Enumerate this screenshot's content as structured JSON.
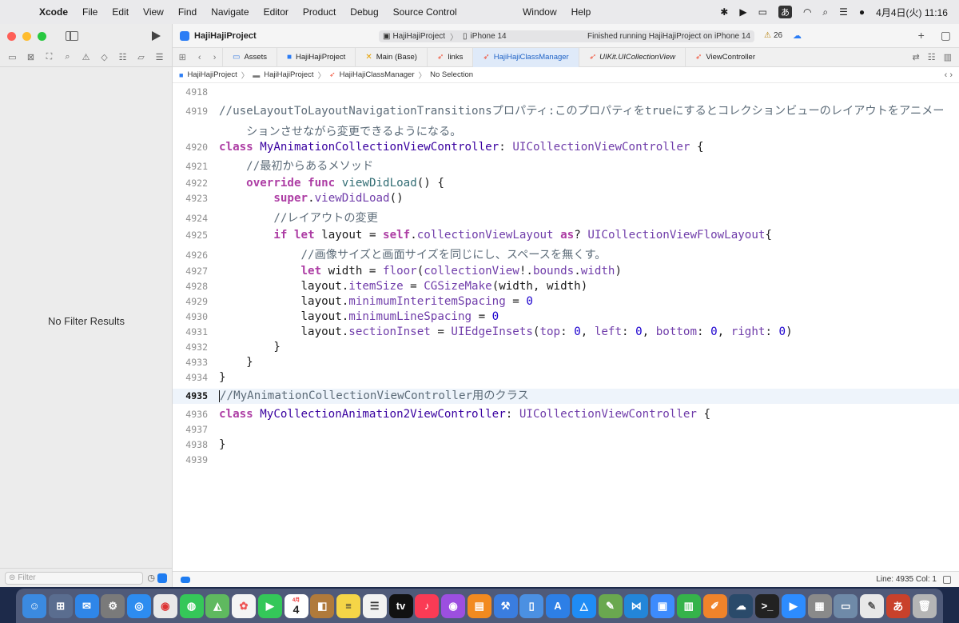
{
  "menubar": {
    "app_name": "Xcode",
    "items": [
      "File",
      "Edit",
      "View",
      "Find",
      "Navigate",
      "Editor",
      "Product",
      "Debug",
      "Source Control"
    ],
    "window_menu": "Window",
    "help_menu": "Help",
    "ime": "あ",
    "clock": "4月4日(火) 11:16"
  },
  "toolbar": {
    "project_title": "HajiHajiProject",
    "scheme": "HajiHajiProject",
    "destination": "iPhone 14",
    "status": "Finished running HajiHajiProject on iPhone 14",
    "warning_count": "26"
  },
  "tabs": [
    {
      "label": "Assets",
      "icon": "asset-catalog-icon"
    },
    {
      "label": "HajiHajiProject",
      "icon": "project-icon"
    },
    {
      "label": "Main (Base)",
      "icon": "storyboard-icon"
    },
    {
      "label": "links",
      "icon": "swift-file-icon"
    },
    {
      "label": "HajiHajiClassManager",
      "icon": "swift-file-icon"
    },
    {
      "label": "UIKit.UICollectionView",
      "icon": "swift-file-icon"
    },
    {
      "label": "ViewController",
      "icon": "swift-file-icon"
    }
  ],
  "breadcrumb": {
    "items": [
      "HajiHajiProject",
      "HajiHajiProject",
      "HajiHajiClassManager",
      "No Selection"
    ]
  },
  "sidebar": {
    "empty_message": "No Filter Results",
    "filter_placeholder": "Filter"
  },
  "editor": {
    "line_numbers": [
      "4918",
      "4919",
      "",
      "4920",
      "4921",
      "4922",
      "4923",
      "4924",
      "4925",
      "4926",
      "4927",
      "4928",
      "4929",
      "4930",
      "4931",
      "4932",
      "4933",
      "4934",
      "4935",
      "4936",
      "4937",
      "4938",
      "4939"
    ],
    "current_line": "4935"
  },
  "statusbar": {
    "position": "Line: 4935  Col: 1"
  },
  "colors": {
    "keyword": "#ad3da4",
    "type": "#703daa",
    "number": "#1c00cf",
    "comment": "#5d6c79",
    "accent": "#1e7cf1"
  },
  "dock": {
    "calendar_day": "4",
    "calendar_month": "4月"
  }
}
